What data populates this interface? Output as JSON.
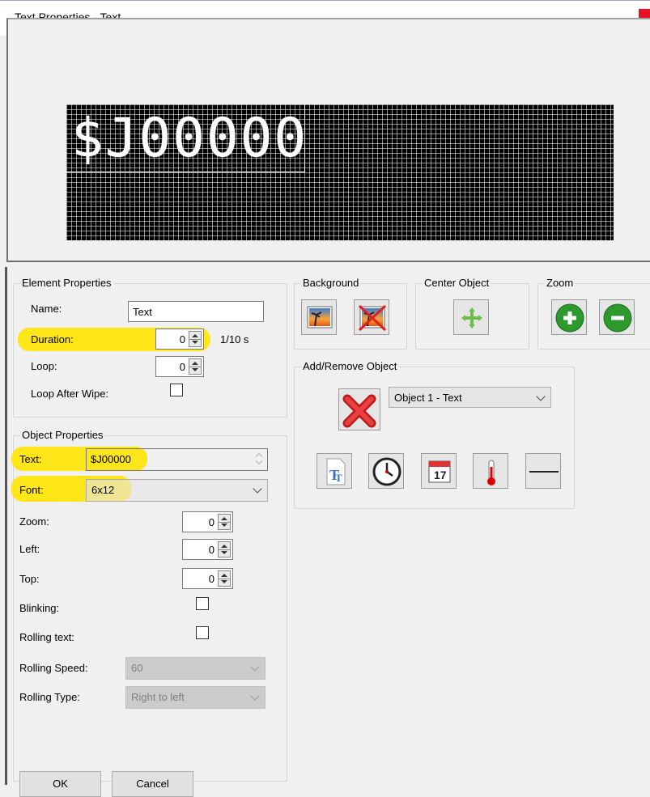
{
  "window": {
    "title": "Text Properties - Text",
    "close_label": "×"
  },
  "preview": {
    "led_text": "$J00000"
  },
  "element_properties": {
    "group_label": "Element Properties",
    "name_label": "Name:",
    "name_value": "Text",
    "duration_label": "Duration:",
    "duration_value": "0",
    "duration_unit": "1/10 s",
    "loop_label": "Loop:",
    "loop_value": "0",
    "loop_after_wipe_label": "Loop After Wipe:"
  },
  "background": {
    "group_label": "Background"
  },
  "center_object": {
    "group_label": "Center Object"
  },
  "zoom_group": {
    "group_label": "Zoom"
  },
  "add_remove": {
    "group_label": "Add/Remove Object",
    "selected_object": "Object 1 - Text",
    "calendar_day": "17"
  },
  "object_properties": {
    "group_label": "Object Properties",
    "text_label": "Text:",
    "text_value": "$J00000",
    "font_label": "Font:",
    "font_value": "6x12",
    "zoom_label": "Zoom:",
    "zoom_value": "0",
    "left_label": "Left:",
    "left_value": "0",
    "top_label": "Top:",
    "top_value": "0",
    "blinking_label": "Blinking:",
    "rolling_text_label": "Rolling text:",
    "rolling_speed_label": "Rolling Speed:",
    "rolling_speed_value": "60",
    "rolling_type_label": "Rolling Type:",
    "rolling_type_value": "Right to left"
  },
  "buttons": {
    "ok": "OK",
    "cancel": "Cancel"
  },
  "colors": {
    "highlight": "#ffe400",
    "led_background": "#000000",
    "zoom_buttons": "#2e9a2e"
  }
}
